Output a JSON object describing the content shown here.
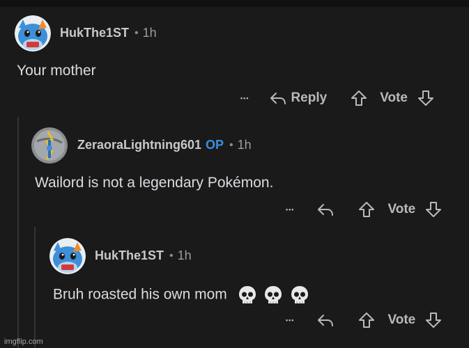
{
  "comments": [
    {
      "username": "HukThe1ST",
      "separator": "•",
      "time": "1h",
      "text": "Your mother",
      "more": "•••",
      "reply_label": "Reply",
      "vote_label": "Vote"
    },
    {
      "username": "ZeraoraLightning601",
      "op_badge": "OP",
      "separator": "•",
      "time": "1h",
      "text": "Wailord is not a legendary Pokémon.",
      "more": "•••",
      "vote_label": "Vote"
    },
    {
      "username": "HukThe1ST",
      "separator": "•",
      "time": "1h",
      "text": "Bruh roasted his own mom",
      "emoji": "💀💀💀",
      "more": "•••",
      "vote_label": "Vote"
    }
  ],
  "watermark": "imgflip.com",
  "colors": {
    "background": "#1a1a1b",
    "op_badge": "#3b8fe0",
    "thread_line": "#343536"
  }
}
